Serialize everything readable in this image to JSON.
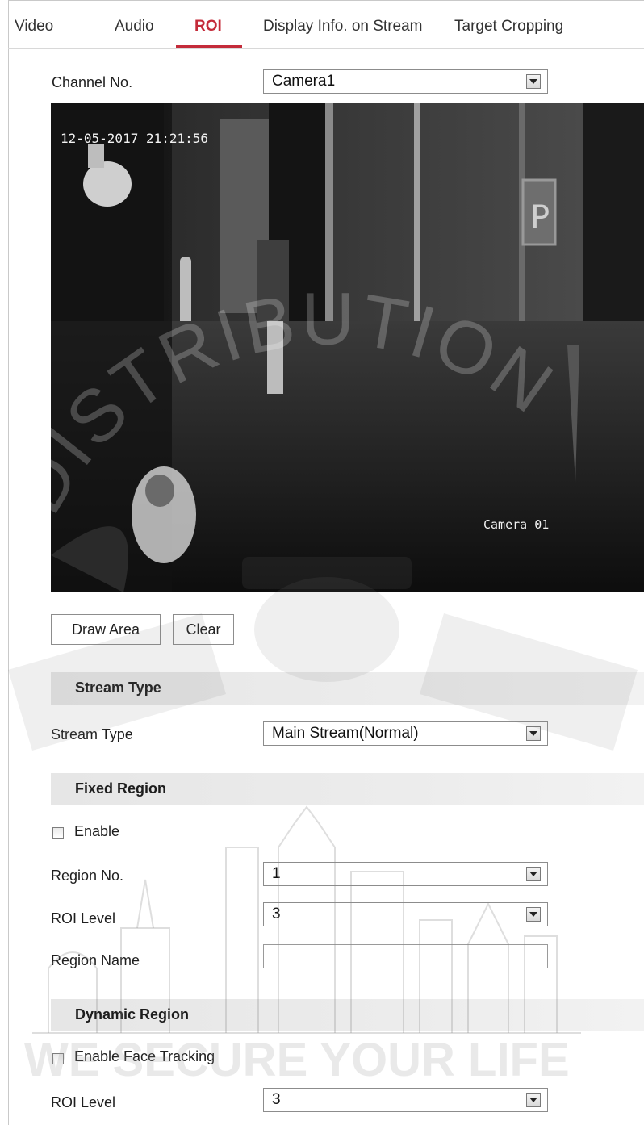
{
  "tabs": [
    {
      "label": "Video"
    },
    {
      "label": "Audio"
    },
    {
      "label": "ROI"
    },
    {
      "label": "Display Info. on Stream"
    },
    {
      "label": "Target Cropping"
    }
  ],
  "channel": {
    "label": "Channel No.",
    "value": "Camera1"
  },
  "video": {
    "timestamp": "12-05-2017 21:21:56",
    "camera_name": "Camera 01"
  },
  "buttons": {
    "draw_area": "Draw Area",
    "clear": "Clear"
  },
  "stream_type_section": {
    "title": "Stream Type",
    "field_label": "Stream Type",
    "value": "Main Stream(Normal)"
  },
  "fixed_region": {
    "title": "Fixed Region",
    "enable_label": "Enable",
    "enable_checked": false,
    "region_no_label": "Region No.",
    "region_no_value": "1",
    "roi_level_label": "ROI Level",
    "roi_level_value": "3",
    "region_name_label": "Region Name",
    "region_name_value": ""
  },
  "dynamic_region": {
    "title": "Dynamic Region",
    "face_tracking_label": "Enable Face Tracking",
    "face_tracking_checked": false,
    "roi_level_label": "ROI Level",
    "roi_level_value": "3"
  },
  "watermark": {
    "text_arc": "DISTRIBUTION",
    "slogan": "WE SECURE YOUR LIFE"
  },
  "colors": {
    "accent": "#c42b3a"
  }
}
